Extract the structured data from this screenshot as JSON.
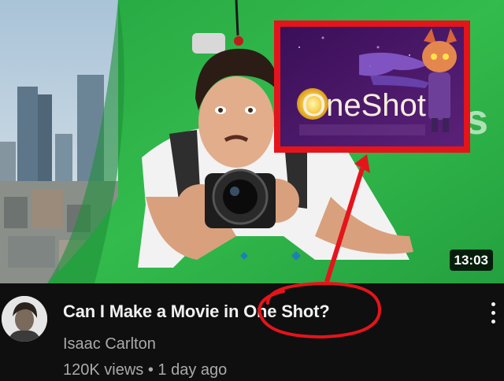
{
  "video": {
    "title": "Can I Make a Movie in One Shot?",
    "channel": "Isaac Carlton",
    "views": "120K views",
    "separator": "•",
    "age": "1 day ago",
    "duration": "13:03"
  },
  "thumbnail": {
    "inset_logo_text": "OneShot",
    "background_color": "#2fb54a",
    "highlight_color": "#e5141b"
  },
  "icons": {
    "menu": "more-vert-icon"
  }
}
